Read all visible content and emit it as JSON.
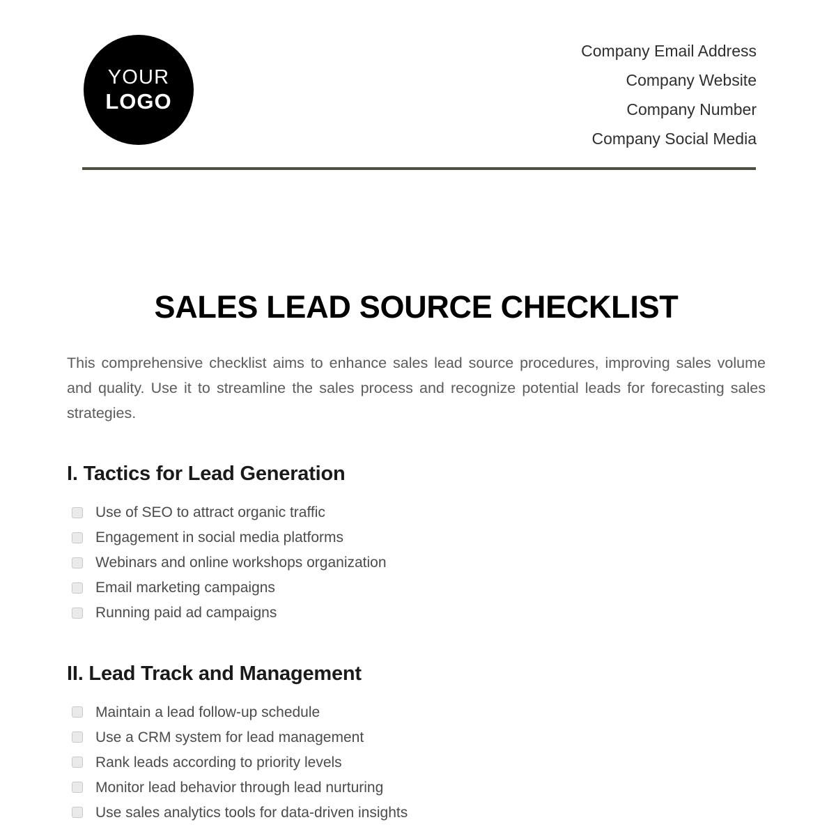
{
  "header": {
    "logo": {
      "line1": "YOUR",
      "line2": "LOGO"
    },
    "contacts": [
      "Company Email Address",
      "Company Website",
      "Company Number",
      "Company Social Media"
    ],
    "rule_color": "#4e4e41"
  },
  "document": {
    "title": "SALES LEAD SOURCE CHECKLIST",
    "intro": "This comprehensive checklist aims to enhance sales lead source procedures, improving sales volume and quality. Use it to streamline the sales process and recognize potential leads for forecasting sales strategies."
  },
  "sections": [
    {
      "heading": "I. Tactics for Lead Generation",
      "items": [
        "Use of SEO to attract organic traffic",
        "Engagement in social media platforms",
        "Webinars and online workshops organization",
        "Email marketing campaigns",
        "Running paid ad campaigns"
      ]
    },
    {
      "heading": "II. Lead Track and Management",
      "items": [
        "Maintain a lead follow-up schedule",
        "Use a CRM system for lead management",
        "Rank leads according to priority levels",
        "Monitor lead behavior through lead nurturing",
        "Use sales analytics tools for data-driven insights"
      ]
    }
  ]
}
